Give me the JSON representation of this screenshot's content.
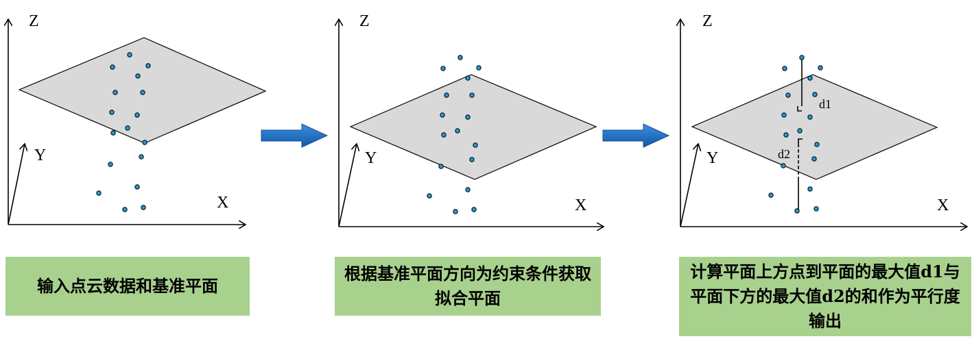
{
  "panels": [
    {
      "axes": {
        "z": "Z",
        "y": "Y",
        "x": "X"
      },
      "caption": "输入点云数据和基准平面"
    },
    {
      "axes": {
        "z": "Z",
        "y": "Y",
        "x": "X"
      },
      "caption": "根据基准平面方向为约束条件获取拟合平面"
    },
    {
      "axes": {
        "z": "Z",
        "y": "Y",
        "x": "X"
      },
      "labels": {
        "d1": "d1",
        "d2": "d2"
      },
      "caption": "计算平面上方点到平面的最大值d1与平面下方的最大值d2的和作为平行度输出"
    }
  ],
  "colors": {
    "plane_fill": "#d9d9d9",
    "point_fill": "#1f9bd4",
    "arrow_fill": "#1f6fc4",
    "caption_bg": "#a9d18e"
  }
}
